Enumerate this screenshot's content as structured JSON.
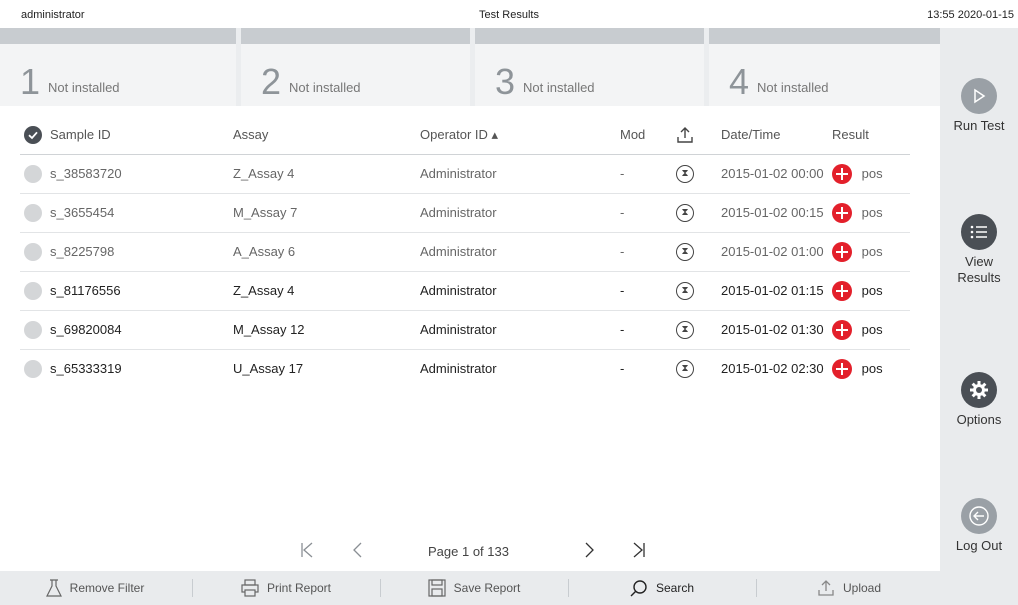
{
  "status_bar": {
    "user": "administrator",
    "title": "Test Results",
    "datetime": "13:55 2020-01-15"
  },
  "modules": [
    {
      "number": "1",
      "status": "Not installed"
    },
    {
      "number": "2",
      "status": "Not installed"
    },
    {
      "number": "3",
      "status": "Not installed"
    },
    {
      "number": "4",
      "status": "Not installed"
    }
  ],
  "table": {
    "headers": {
      "sample_id": "Sample ID",
      "assay": "Assay",
      "operator_id": "Operator ID ▴",
      "mod": "Mod",
      "date_time": "Date/Time",
      "result": "Result"
    },
    "rows": [
      {
        "sample_id": "s_38583720",
        "assay": "Z_Assay 4",
        "operator": "Administrator",
        "mod": "-",
        "datetime": "2015-01-02 00:00",
        "result": "pos"
      },
      {
        "sample_id": "s_3655454",
        "assay": "M_Assay 7",
        "operator": "Administrator",
        "mod": "-",
        "datetime": "2015-01-02 00:15",
        "result": "pos"
      },
      {
        "sample_id": "s_8225798",
        "assay": "A_Assay 6",
        "operator": "Administrator",
        "mod": "-",
        "datetime": "2015-01-02 01:00",
        "result": "pos"
      },
      {
        "sample_id": "s_81176556",
        "assay": "Z_Assay 4",
        "operator": "Administrator",
        "mod": "-",
        "datetime": "2015-01-02 01:15",
        "result": "pos"
      },
      {
        "sample_id": "s_69820084",
        "assay": "M_Assay 12",
        "operator": "Administrator",
        "mod": "-",
        "datetime": "2015-01-02 01:30",
        "result": "pos"
      },
      {
        "sample_id": "s_65333319",
        "assay": "U_Assay 17",
        "operator": "Administrator",
        "mod": "-",
        "datetime": "2015-01-02 02:30",
        "result": "pos"
      }
    ]
  },
  "pagination": {
    "page_text": "Page 1 of 133"
  },
  "sidebar": {
    "run_test": "Run Test",
    "view_results": "View\nResults",
    "options": "Options",
    "log_out": "Log Out"
  },
  "toolbar": {
    "remove_filter": "Remove Filter",
    "print_report": "Print Report",
    "save_report": "Save Report",
    "search": "Search",
    "upload": "Upload"
  },
  "colors": {
    "positive": "#e3202b",
    "sidebar_icon": "#4a4f55",
    "run_test_icon": "#9aa0a6",
    "module_header": "#c8ccd0"
  }
}
